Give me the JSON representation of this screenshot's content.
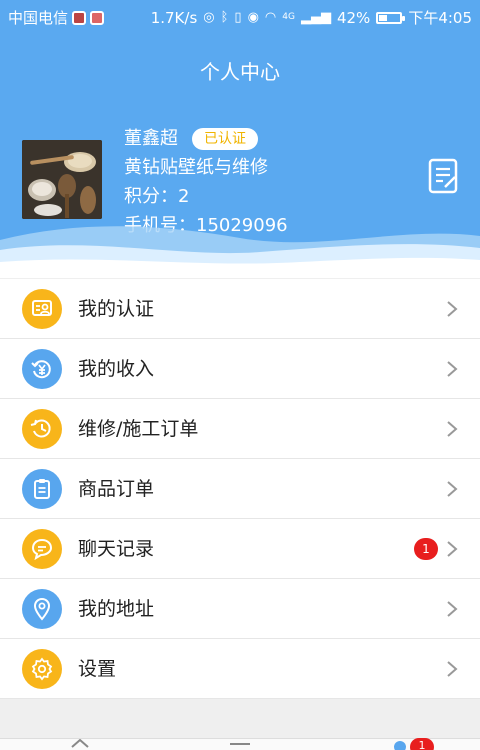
{
  "status_bar": {
    "carrier": "中国电信",
    "speed": "1.7K/s",
    "network": "4G",
    "battery": "42%",
    "battery_level": 0.42,
    "time": "下午4:05"
  },
  "header": {
    "title": "个人中心"
  },
  "profile": {
    "name": "董鑫超",
    "verified_label": "已认证",
    "shop": "黄钻贴壁纸与维修",
    "points": "积分：2",
    "phone": "手机号：15029096"
  },
  "menu": {
    "items": [
      {
        "label": "我的认证",
        "icon": "certificate-icon",
        "color": "#f8b51a"
      },
      {
        "label": "我的收入",
        "icon": "income-icon",
        "color": "#58a6ee"
      },
      {
        "label": "维修/施工订单",
        "icon": "history-icon",
        "color": "#f8b51a"
      },
      {
        "label": "商品订单",
        "icon": "clipboard-icon",
        "color": "#58a6ee"
      },
      {
        "label": "聊天记录",
        "icon": "chat-icon",
        "color": "#f8b51a",
        "badge": "1"
      },
      {
        "label": "我的地址",
        "icon": "location-pin-icon",
        "color": "#58a6ee"
      },
      {
        "label": "设置",
        "icon": "gear-icon",
        "color": "#f8b51a"
      }
    ]
  },
  "tab_bar": {
    "badge": "1"
  },
  "colors": {
    "header_blue": "#5aa9f0",
    "icon_yellow": "#f8b51a",
    "icon_blue": "#58a6ee",
    "badge_red": "#e81e1e",
    "verify_text": "#f0b400"
  }
}
